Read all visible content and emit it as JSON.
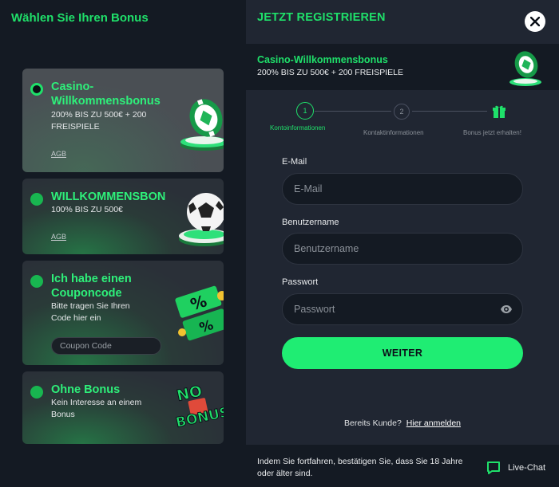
{
  "left": {
    "title": "Wählen Sie Ihren Bonus",
    "cards": [
      {
        "title_line1": "Casino-",
        "title_line2": "Willkommensbonus",
        "desc_line1": "200% BIS ZU 500€ + 200",
        "desc_line2": "FREISPIELE",
        "link": "AGB",
        "selected": true
      },
      {
        "title_line1": "WILLKOMMENSBON",
        "desc_line1": "100% BIS ZU 500€",
        "link": "AGB",
        "selected": false
      },
      {
        "title_line1": "Ich habe einen",
        "title_line2": "Couponcode",
        "desc_line1": "Bitte tragen Sie Ihren",
        "desc_line2": "Code hier ein",
        "input_placeholder": "Coupon Code",
        "selected": false
      },
      {
        "title_line1": "Ohne Bonus",
        "desc_line1": "Kein Interesse an einem",
        "desc_line2": "Bonus",
        "badge_line1": "NO",
        "badge_line2": "BONUS",
        "selected": false
      }
    ]
  },
  "right": {
    "title": "JETZT REGISTRIEREN",
    "banner": {
      "title": "Casino-Willkommensbonus",
      "subtitle": "200% BIS ZU 500€ + 200 FREISPIELE"
    },
    "steps": [
      {
        "number": "1",
        "label": "Kontoinformationen",
        "active": true
      },
      {
        "number": "2",
        "label": "Kontaktinformationen",
        "active": false
      },
      {
        "icon": "gift-icon",
        "label": "Bonus jetzt erhalten!",
        "active": false
      }
    ],
    "fields": [
      {
        "label": "E-Mail",
        "placeholder": "E-Mail"
      },
      {
        "label": "Benutzername",
        "placeholder": "Benutzername"
      },
      {
        "label": "Passwort",
        "placeholder": "Passwort"
      }
    ],
    "submit_label": "WEITER",
    "login_prompt": "Bereits Kunde?",
    "login_link": "Hier anmelden",
    "footer_text": "Indem Sie fortfahren, bestätigen Sie, dass Sie 18 Jahre oder älter sind.",
    "livechat_label": "Live-Chat"
  },
  "colors": {
    "accent": "#1fe06a",
    "button": "#1fed73",
    "panel_dark": "#141a23",
    "panel": "#202632"
  }
}
